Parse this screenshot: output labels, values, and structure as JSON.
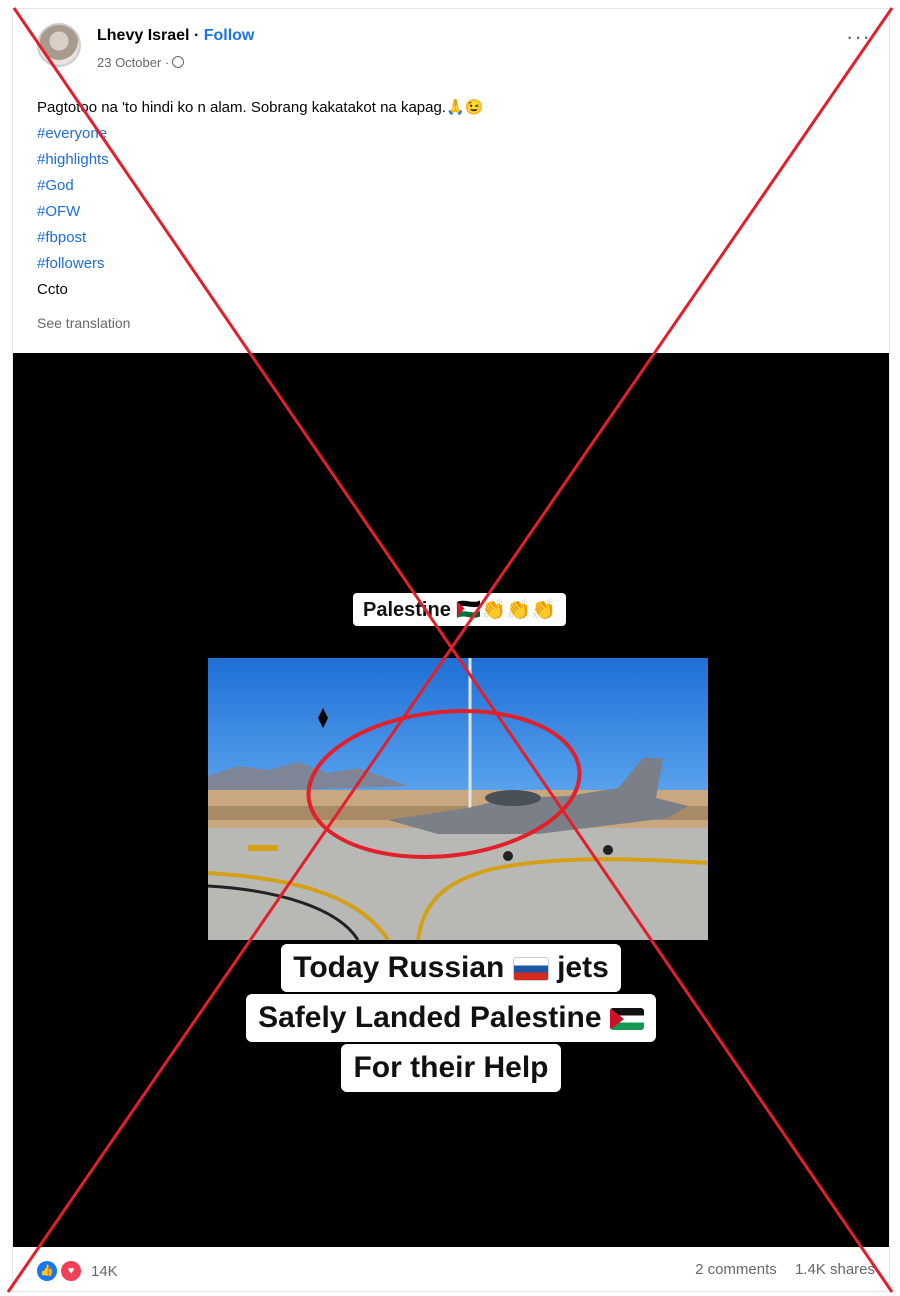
{
  "post": {
    "author": "Lhevy Israel",
    "separator": " · ",
    "follow_label": "Follow",
    "date": "23 October ·",
    "more_label": "···",
    "text_line": "Pagtotoo na 'to hindi ko n alam. Sobrang kakatakot na kapag.🙏😉",
    "hashtags": [
      "#everyone",
      "#highlights",
      "#God",
      "#OFW",
      "#fbpost",
      "#followers"
    ],
    "trailing_text": "Ccto",
    "see_translation": "See translation"
  },
  "media": {
    "top_badge": "Palestine 🇵🇸👏👏👏",
    "caption": {
      "line1_a": "Today Russian",
      "line1_b": "jets",
      "line2": "Safely Landed Palestine",
      "line3": "For their Help"
    }
  },
  "footer": {
    "reaction_count": "14K",
    "comments": "2 comments",
    "shares": "1.4K shares"
  },
  "icons": {
    "like": "like-icon",
    "love": "love-icon",
    "globe": "globe-icon",
    "more": "more-options-icon"
  },
  "colors": {
    "link": "#1b74e4",
    "cross": "#e0202a",
    "like": "#1877f2",
    "love": "#f33e58"
  }
}
